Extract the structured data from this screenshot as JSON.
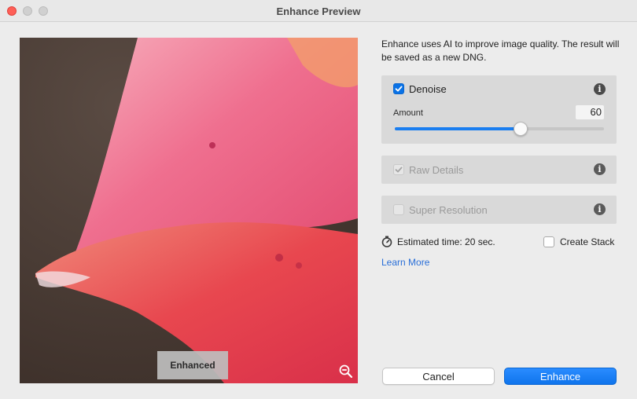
{
  "window": {
    "title": "Enhance Preview",
    "controls": [
      "close",
      "minimize",
      "zoom"
    ]
  },
  "preview": {
    "overlay_label": "Enhanced",
    "zoom_icon": "zoom-out-icon"
  },
  "description": "Enhance uses AI to improve image quality. The result will be saved as a new DNG.",
  "options": {
    "denoise": {
      "label": "Denoise",
      "checked": true,
      "enabled": true,
      "amount_label": "Amount",
      "amount_value": "60",
      "amount_fraction": 0.6
    },
    "raw_details": {
      "label": "Raw Details",
      "checked": true,
      "enabled": false
    },
    "super_resolution": {
      "label": "Super Resolution",
      "checked": false,
      "enabled": false
    }
  },
  "estimate": {
    "icon": "stopwatch-icon",
    "text": "Estimated time: 20 sec."
  },
  "create_stack": {
    "label": "Create Stack",
    "checked": false
  },
  "learn_more": "Learn More",
  "buttons": {
    "cancel": "Cancel",
    "enhance": "Enhance"
  },
  "colors": {
    "accent": "#0a72e6",
    "link": "#2a6fd8",
    "close": "#fe5f57"
  }
}
